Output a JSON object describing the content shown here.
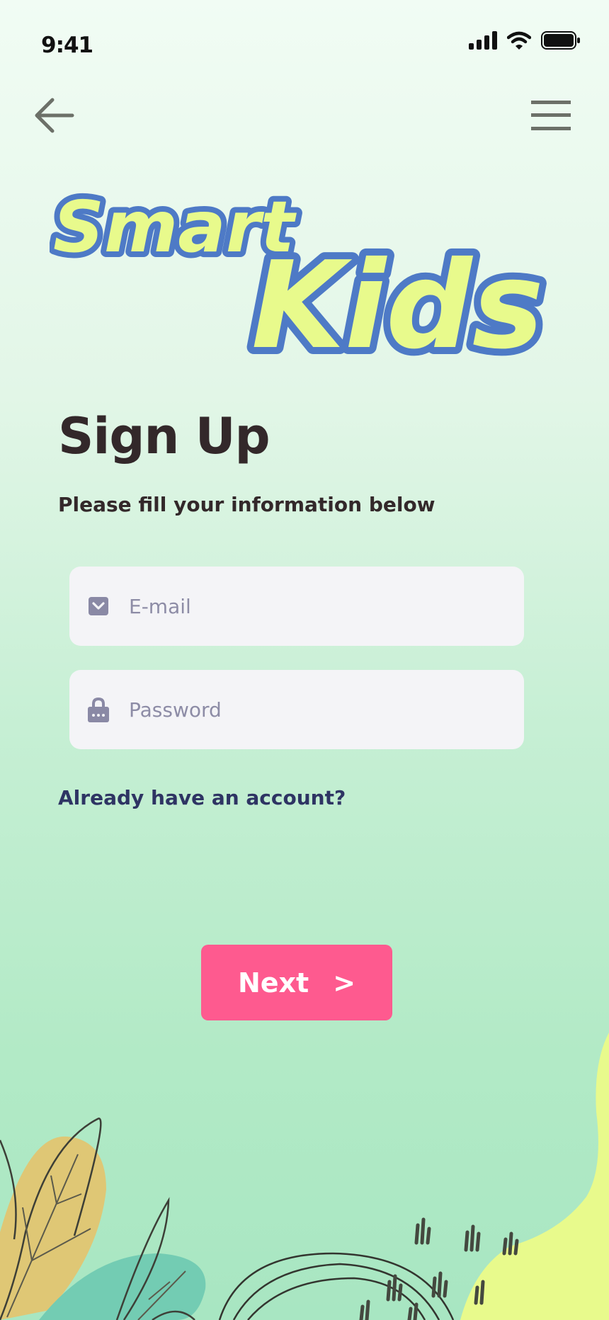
{
  "status_bar": {
    "time": "9:41"
  },
  "navigation": {
    "back_icon": "arrow-left-icon",
    "menu_icon": "hamburger-menu-icon"
  },
  "logo": {
    "word1": "Smart",
    "word2": "Kids",
    "fill_color": "#e8fa8c",
    "outline_color": "#4e7ac6"
  },
  "title": "Sign Up",
  "subtitle": "Please fill your information below",
  "form": {
    "email": {
      "placeholder": "E-mail",
      "value": "",
      "icon": "envelope-icon"
    },
    "password": {
      "placeholder": "Password",
      "value": "",
      "icon": "lock-icon"
    }
  },
  "account_link": "Already have an account?",
  "next_button": {
    "label": "Next",
    "chevron": ">",
    "color": "#fe5a8f"
  },
  "colors": {
    "background_top": "#f1fcf4",
    "background_bottom": "#a8e6c2",
    "text_primary": "#33282a",
    "link": "#2e3463"
  }
}
